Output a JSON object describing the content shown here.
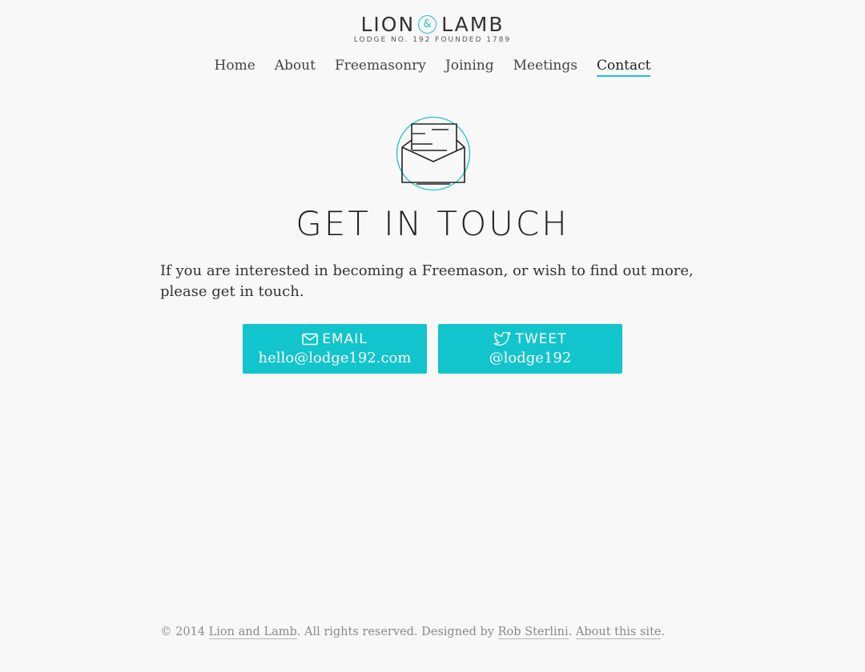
{
  "logo": {
    "left": "LION",
    "amp": "&",
    "right": "LAMB",
    "subtitle": "LODGE NO. 192 FOUNDED 1789",
    "accent_color": "#1cc4cc"
  },
  "nav": {
    "items": [
      {
        "label": "Home"
      },
      {
        "label": "About"
      },
      {
        "label": "Freemasonry"
      },
      {
        "label": "Joining"
      },
      {
        "label": "Meetings"
      },
      {
        "label": "Contact",
        "active": true
      }
    ]
  },
  "main": {
    "icon": "open-envelope-icon",
    "heading": "GET IN TOUCH",
    "intro": "If you are interested in becoming a Freemason, or wish to find out more, please get in touch."
  },
  "buttons": {
    "email": {
      "icon": "mail-icon",
      "label": "EMAIL",
      "value": "hello@lodge192.com"
    },
    "tweet": {
      "icon": "twitter-bird-icon",
      "label": "TWEET",
      "value": "@lodge192"
    },
    "color": "#12c4cc"
  },
  "footer": {
    "prefix": "© 2014 ",
    "site_link": "Lion and Lamb",
    "middle": ". All rights reserved. Designed by ",
    "designer_link": "Rob Sterlini",
    "separator": ". ",
    "about_link": "About this site",
    "suffix": "."
  }
}
